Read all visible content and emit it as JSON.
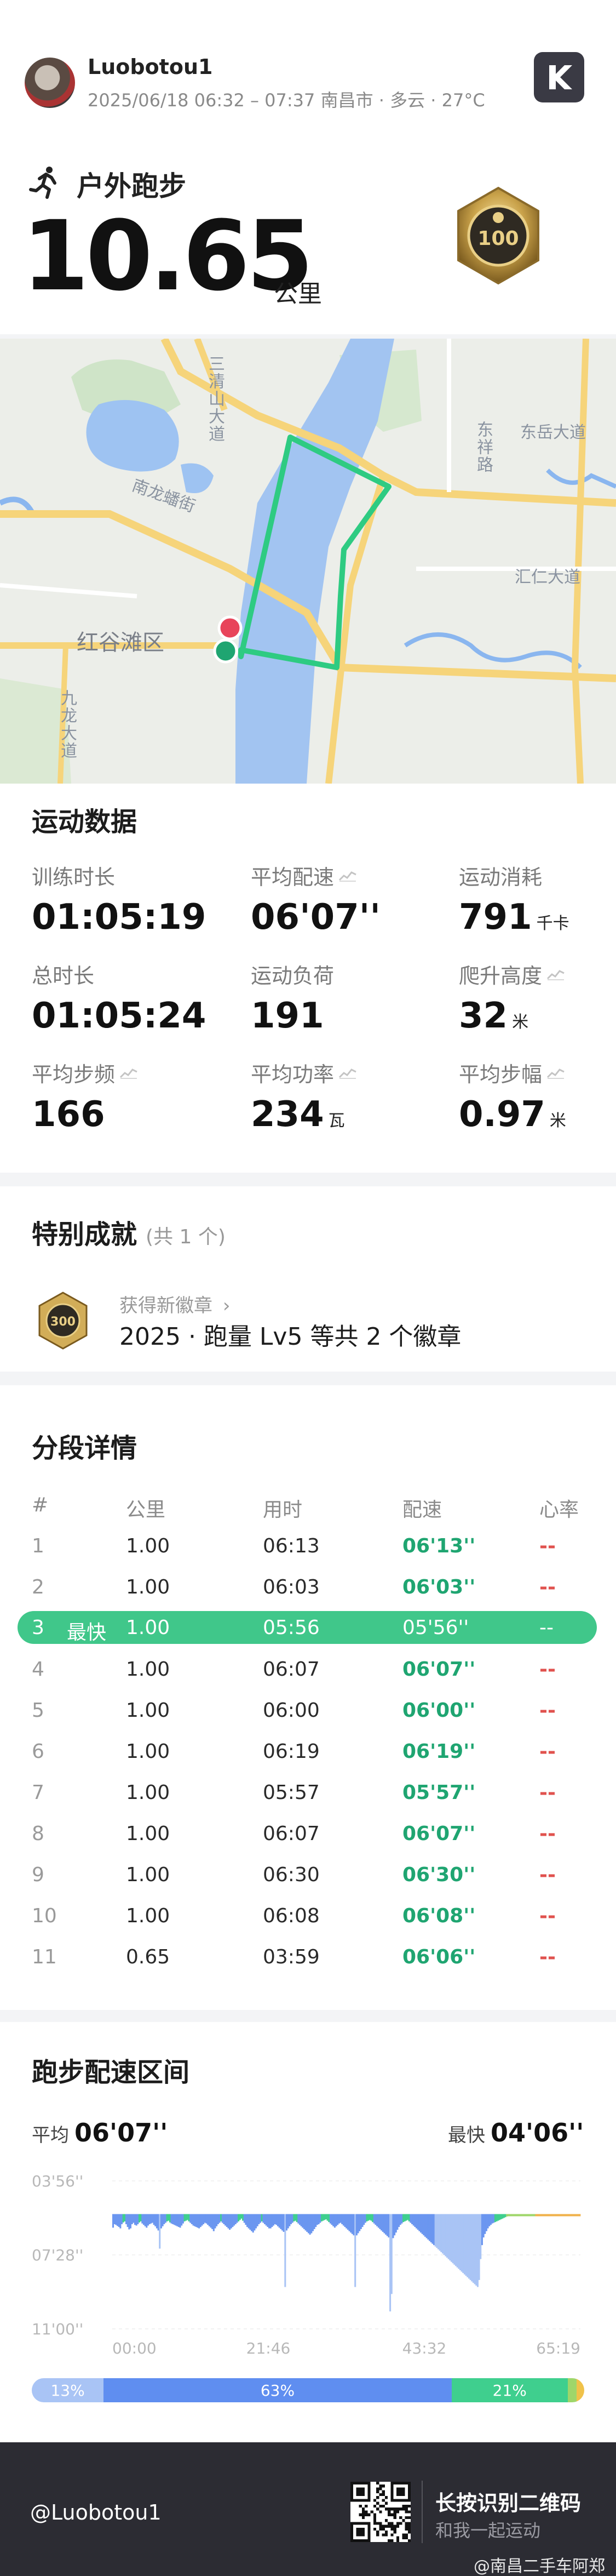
{
  "header": {
    "username": "Luobotou1",
    "meta": "2025/06/18 06:32 – 07:37 南昌市 · 多云 · 27°C",
    "app_logo_icon": "keep-logo-icon",
    "sport_icon": "running-icon",
    "sport_title": "户外跑步",
    "distance": "10.65",
    "distance_unit": "公里",
    "medal_value": "100"
  },
  "map": {
    "labels": {
      "road1": "三清山大道",
      "road2": "南龙蟠街",
      "district": "红谷滩区",
      "road3": "九龙大道",
      "road4": "东祥路",
      "road5": "东岳大道",
      "road6": "汇仁大道"
    },
    "route_color": "#2ecb82",
    "start_color": "#1fa571",
    "end_color": "#e8445a"
  },
  "stats": {
    "title": "运动数据",
    "items": [
      {
        "label": "训练时长",
        "value": "01:05:19",
        "unit": "",
        "trend": false
      },
      {
        "label": "平均配速",
        "value": "06'07''",
        "unit": "",
        "trend": true
      },
      {
        "label": "运动消耗",
        "value": "791",
        "unit": "千卡",
        "trend": false
      },
      {
        "label": "总时长",
        "value": "01:05:24",
        "unit": "",
        "trend": false
      },
      {
        "label": "运动负荷",
        "value": "191",
        "unit": "",
        "trend": false
      },
      {
        "label": "爬升高度",
        "value": "32",
        "unit": "米",
        "trend": true
      },
      {
        "label": "平均步频",
        "value": "166",
        "unit": "",
        "trend": true
      },
      {
        "label": "平均功率",
        "value": "234",
        "unit": "瓦",
        "trend": true
      },
      {
        "label": "平均步幅",
        "value": "0.97",
        "unit": "米",
        "trend": true
      }
    ]
  },
  "achievements": {
    "title": "特别成就",
    "count": "(共 1 个)",
    "subtitle": "获得新徽章",
    "main": "2025 · 跑量 Lv5 等共 2 个徽章",
    "badge_value": "300"
  },
  "splits": {
    "title": "分段详情",
    "headers": {
      "idx": "#",
      "km": "公里",
      "time": "用时",
      "pace": "配速",
      "hr": "心率"
    },
    "fastest_label": "最快",
    "rows": [
      {
        "idx": "1",
        "km": "1.00",
        "time": "06:13",
        "pace": "06'13''",
        "hr": "--",
        "fast": false
      },
      {
        "idx": "2",
        "km": "1.00",
        "time": "06:03",
        "pace": "06'03''",
        "hr": "--",
        "fast": false
      },
      {
        "idx": "3",
        "km": "1.00",
        "time": "05:56",
        "pace": "05'56''",
        "hr": "--",
        "fast": true
      },
      {
        "idx": "4",
        "km": "1.00",
        "time": "06:07",
        "pace": "06'07''",
        "hr": "--",
        "fast": false
      },
      {
        "idx": "5",
        "km": "1.00",
        "time": "06:00",
        "pace": "06'00''",
        "hr": "--",
        "fast": false
      },
      {
        "idx": "6",
        "km": "1.00",
        "time": "06:19",
        "pace": "06'19''",
        "hr": "--",
        "fast": false
      },
      {
        "idx": "7",
        "km": "1.00",
        "time": "05:57",
        "pace": "05'57''",
        "hr": "--",
        "fast": false
      },
      {
        "idx": "8",
        "km": "1.00",
        "time": "06:07",
        "pace": "06'07''",
        "hr": "--",
        "fast": false
      },
      {
        "idx": "9",
        "km": "1.00",
        "time": "06:30",
        "pace": "06'30''",
        "hr": "--",
        "fast": false
      },
      {
        "idx": "10",
        "km": "1.00",
        "time": "06:08",
        "pace": "06'08''",
        "hr": "--",
        "fast": false
      },
      {
        "idx": "11",
        "km": "0.65",
        "time": "03:59",
        "pace": "06'06''",
        "hr": "--",
        "fast": false
      }
    ]
  },
  "pace_zones": {
    "title": "跑步配速区间",
    "avg_label": "平均",
    "avg_value": "06'07''",
    "best_label": "最快",
    "best_value": "04'06''",
    "y_labels": [
      "03'56''",
      "07'28''",
      "11'00''"
    ],
    "x_labels": [
      "00:00",
      "21:46",
      "43:32",
      "65:19"
    ],
    "zones": [
      {
        "label": "13%",
        "share": 13,
        "color": "#a9c4f5"
      },
      {
        "label": "63%",
        "share": 63,
        "color": "#5f8ef0"
      },
      {
        "label": "21%",
        "share": 21,
        "color": "#3fcf8e"
      },
      {
        "label": "",
        "share": 1.6,
        "color": "#9fd66a"
      },
      {
        "label": "",
        "share": 1.4,
        "color": "#f0c24a"
      }
    ]
  },
  "chart_data": {
    "type": "bar",
    "title": "",
    "xlabel": "",
    "ylabel": "",
    "x_ticks": [
      "00:00",
      "21:46",
      "43:32",
      "65:19"
    ],
    "y_ticks": [
      "03'56''",
      "07'28''",
      "11'00''"
    ],
    "x_range_minutes": [
      0,
      65.32
    ],
    "y_range_sec_per_km": [
      236,
      660
    ],
    "series": [
      {
        "values_sec_per_km": [
          370,
          360,
          362,
          365,
          368,
          372,
          360,
          355,
          352,
          360,
          368,
          375,
          372,
          360,
          356,
          362,
          364,
          360,
          355,
          352,
          358,
          362,
          366,
          370,
          364,
          360,
          358,
          356,
          362,
          366,
          372,
          378,
          430,
          372,
          366,
          360,
          356,
          352,
          350,
          355,
          358,
          360,
          362,
          364,
          366,
          368,
          370,
          364,
          358,
          352,
          350,
          348,
          352,
          356,
          360,
          364,
          366,
          368,
          370,
          372,
          368,
          364,
          360,
          356,
          358,
          362,
          366,
          370,
          374,
          380,
          372,
          366,
          360,
          356,
          352,
          356,
          360,
          364,
          368,
          372,
          376,
          372,
          368,
          364,
          360,
          356,
          352,
          348,
          344,
          350,
          356,
          362,
          368,
          372,
          376,
          380,
          384,
          378,
          372,
          366,
          360,
          356,
          352,
          356,
          360,
          364,
          368,
          372,
          372,
          368,
          364,
          360,
          362,
          366,
          370,
          374,
          378,
          382,
          540,
          378,
          372,
          366,
          360,
          356,
          352,
          350,
          354,
          358,
          362,
          366,
          370,
          374,
          378,
          382,
          386,
          390,
          386,
          380,
          374,
          368,
          362,
          360,
          356,
          352,
          350,
          348,
          346,
          350,
          354,
          358,
          362,
          366,
          370,
          366,
          362,
          358,
          356,
          360,
          364,
          368,
          372,
          376,
          380,
          384,
          388,
          392,
          540,
          392,
          386,
          380,
          374,
          368,
          362,
          356,
          352,
          350,
          348,
          350,
          354,
          358,
          362,
          366,
          370,
          374,
          378,
          382,
          386,
          390,
          394,
          398,
          610,
          560,
          400,
          392,
          384,
          376,
          368,
          362,
          358,
          354,
          352,
          350,
          348,
          352,
          356,
          360,
          364,
          368,
          372,
          376,
          380,
          384,
          388,
          392,
          396,
          400,
          404,
          408,
          412,
          416,
          420,
          424,
          428,
          432,
          436,
          440,
          444,
          448,
          452,
          456,
          460,
          464,
          468,
          472,
          476,
          480,
          484,
          488,
          492,
          496,
          500,
          504,
          508,
          512,
          516,
          520,
          524,
          528,
          532,
          536,
          540,
          520,
          460,
          420,
          398,
          388,
          380,
          372,
          366,
          362,
          358,
          356,
          354,
          352,
          350,
          348,
          346,
          344,
          342,
          340,
          338,
          336,
          334,
          332,
          330,
          328,
          326,
          324,
          322,
          320,
          318,
          316,
          314,
          312,
          310,
          308,
          306,
          304,
          302,
          300,
          298,
          296,
          294,
          292,
          290,
          288,
          286,
          284,
          282,
          280,
          278,
          276,
          274,
          272,
          270,
          268,
          266,
          264,
          262,
          260,
          258,
          256,
          254,
          252,
          250,
          248,
          246,
          244,
          242,
          240,
          246
        ]
      }
    ],
    "zones_percent": [
      13,
      63,
      21,
      1.6,
      1.4
    ]
  },
  "footer": {
    "handle": "@Luobotou1",
    "cta": "长按识别二维码",
    "cta_sub": "和我一起运动"
  },
  "watermark": "@南昌二手车阿郑"
}
